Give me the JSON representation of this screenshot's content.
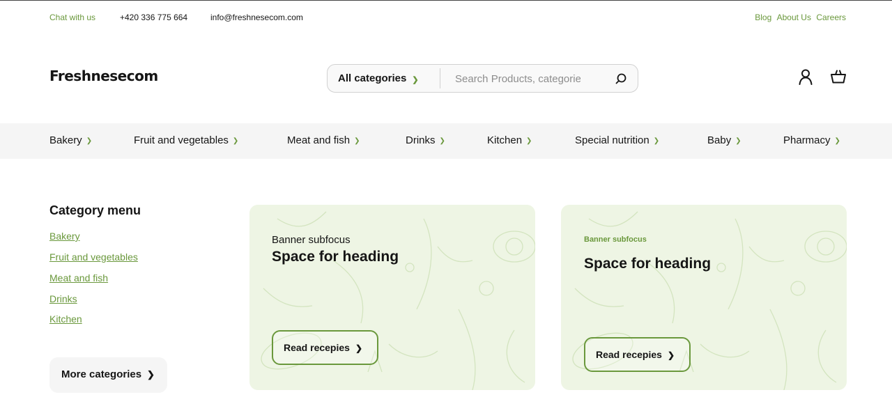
{
  "topbar": {
    "chat": "Chat with us",
    "phone": "+420 336 775 664",
    "email": "info@freshnesecom.com",
    "links": [
      "Blog",
      "About Us",
      "Careers"
    ]
  },
  "header": {
    "logo": "Freshnesecom",
    "search": {
      "category": "All categories",
      "placeholder": "Search Products, categories ..."
    }
  },
  "nav": [
    {
      "label": "Bakery"
    },
    {
      "label": "Fruit and vegetables"
    },
    {
      "label": "Meat and fish"
    },
    {
      "label": "Drinks"
    },
    {
      "label": "Kitchen"
    },
    {
      "label": "Special nutrition"
    },
    {
      "label": "Baby"
    },
    {
      "label": "Pharmacy"
    }
  ],
  "sidebar": {
    "title": "Category menu",
    "links": [
      "Bakery",
      "Fruit and vegetables",
      "Meat and fish",
      "Drinks",
      "Kitchen"
    ],
    "more_label": "More categories"
  },
  "banners": [
    {
      "subfocus": "Banner subfocus",
      "heading": "Space for heading",
      "button": "Read recepies"
    },
    {
      "subfocus": "Banner subfocus",
      "heading": "Space for heading",
      "button": "Read recepies"
    }
  ],
  "colors": {
    "accent": "#6a983c",
    "banner_bg": "#eef5e4",
    "nav_bg": "#f5f5f5"
  },
  "icons": [
    "chevron-down-icon",
    "search-icon",
    "user-icon",
    "cart-icon",
    "chevron-right-icon"
  ]
}
